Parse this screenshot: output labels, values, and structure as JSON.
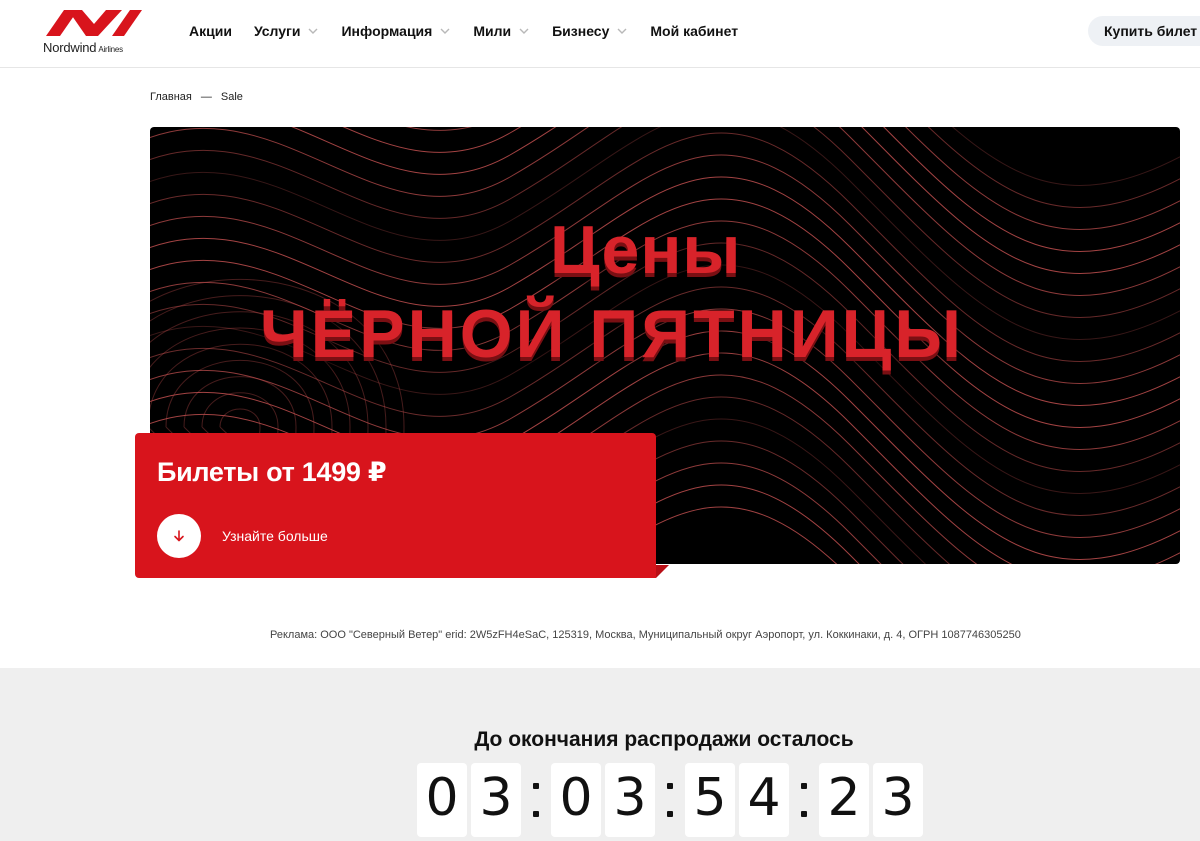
{
  "header": {
    "logo_word": "Nordwind",
    "logo_sub": "Airlines",
    "nav": [
      {
        "label": "Акции",
        "has_dropdown": false
      },
      {
        "label": "Услуги",
        "has_dropdown": true
      },
      {
        "label": "Информация",
        "has_dropdown": true
      },
      {
        "label": "Мили",
        "has_dropdown": true
      },
      {
        "label": "Бизнесу",
        "has_dropdown": true
      },
      {
        "label": "Мой кабинет",
        "has_dropdown": false
      }
    ],
    "buy_button": "Купить билет"
  },
  "breadcrumb": {
    "home": "Главная",
    "separator": "—",
    "current": "Sale"
  },
  "banner": {
    "line1": "Цены",
    "line2": "ЧЁРНОЙ ПЯТНИЦЫ"
  },
  "promo": {
    "title": "Билеты от 1499 ₽",
    "cta_label": "Узнайте больше",
    "cta_icon": "arrow-down-icon"
  },
  "ad_disclaimer": "Реклама: ООО \"Северный Ветер\" erid: 2W5zFH4eSaC, 125319, Москва, Муниципальный округ Аэропорт, ул. Коккинаки, д. 4, ОГРН 1087746305250",
  "countdown": {
    "title": "До окончания распродажи осталось",
    "groups": [
      [
        "0",
        "3"
      ],
      [
        "0",
        "3"
      ],
      [
        "5",
        "4"
      ],
      [
        "2",
        "3"
      ]
    ]
  },
  "colors": {
    "brand_red": "#d8141c",
    "banner_bg": "#000000",
    "section_bg": "#efefef"
  }
}
